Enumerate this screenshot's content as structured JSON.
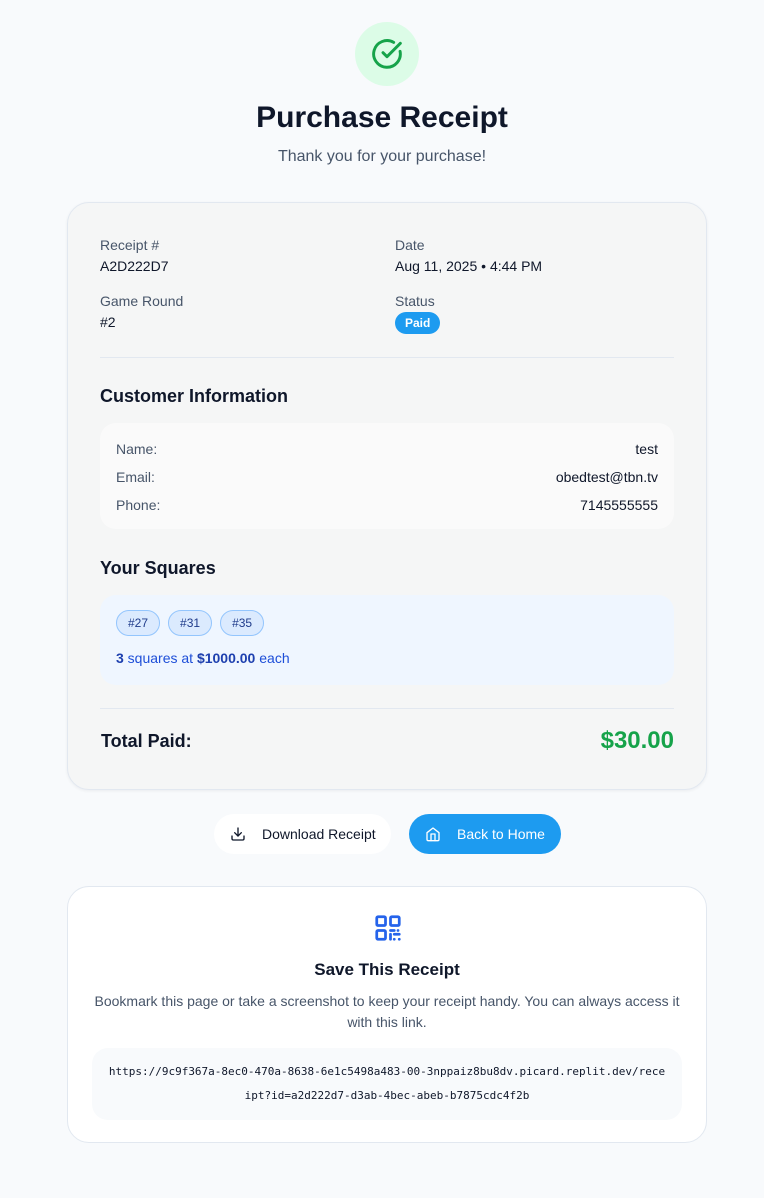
{
  "header": {
    "title": "Purchase Receipt",
    "subtitle": "Thank you for your purchase!",
    "icon": "check-circle-icon"
  },
  "receipt": {
    "receipt_label": "Receipt #",
    "receipt_value": "A2D222D7",
    "date_label": "Date",
    "date_value": "Aug 11, 2025 • 4:44 PM",
    "round_label": "Game Round",
    "round_value": "#2",
    "status_label": "Status",
    "status_value": "Paid"
  },
  "customer": {
    "title": "Customer Information",
    "rows": [
      {
        "label": "Name:",
        "value": "test"
      },
      {
        "label": "Email:",
        "value": "obedtest@tbn.tv"
      },
      {
        "label": "Phone:",
        "value": "7145555555"
      }
    ]
  },
  "squares": {
    "title": "Your Squares",
    "items": [
      "#27",
      "#31",
      "#35"
    ],
    "count": "3",
    "text_mid": " squares at ",
    "price": "$1000.00",
    "text_end": " each"
  },
  "total": {
    "label": "Total Paid:",
    "value": "$30.00"
  },
  "actions": {
    "download_label": "Download Receipt",
    "home_label": "Back to Home"
  },
  "save": {
    "title": "Save This Receipt",
    "text": "Bookmark this page or take a screenshot to keep your receipt handy. You can always access it with this link.",
    "link": "https://9c9f367a-8ec0-470a-8638-6e1c5498a483-00-3nppaiz8bu8dv.picard.replit.dev/receipt?id=a2d222d7-d3ab-4bec-abeb-b7875cdc4f2b"
  },
  "colors": {
    "accent": "#1d9bf0",
    "success": "#16a34a",
    "success_bg": "#dcfce7",
    "squares_bg": "#eff6ff"
  }
}
